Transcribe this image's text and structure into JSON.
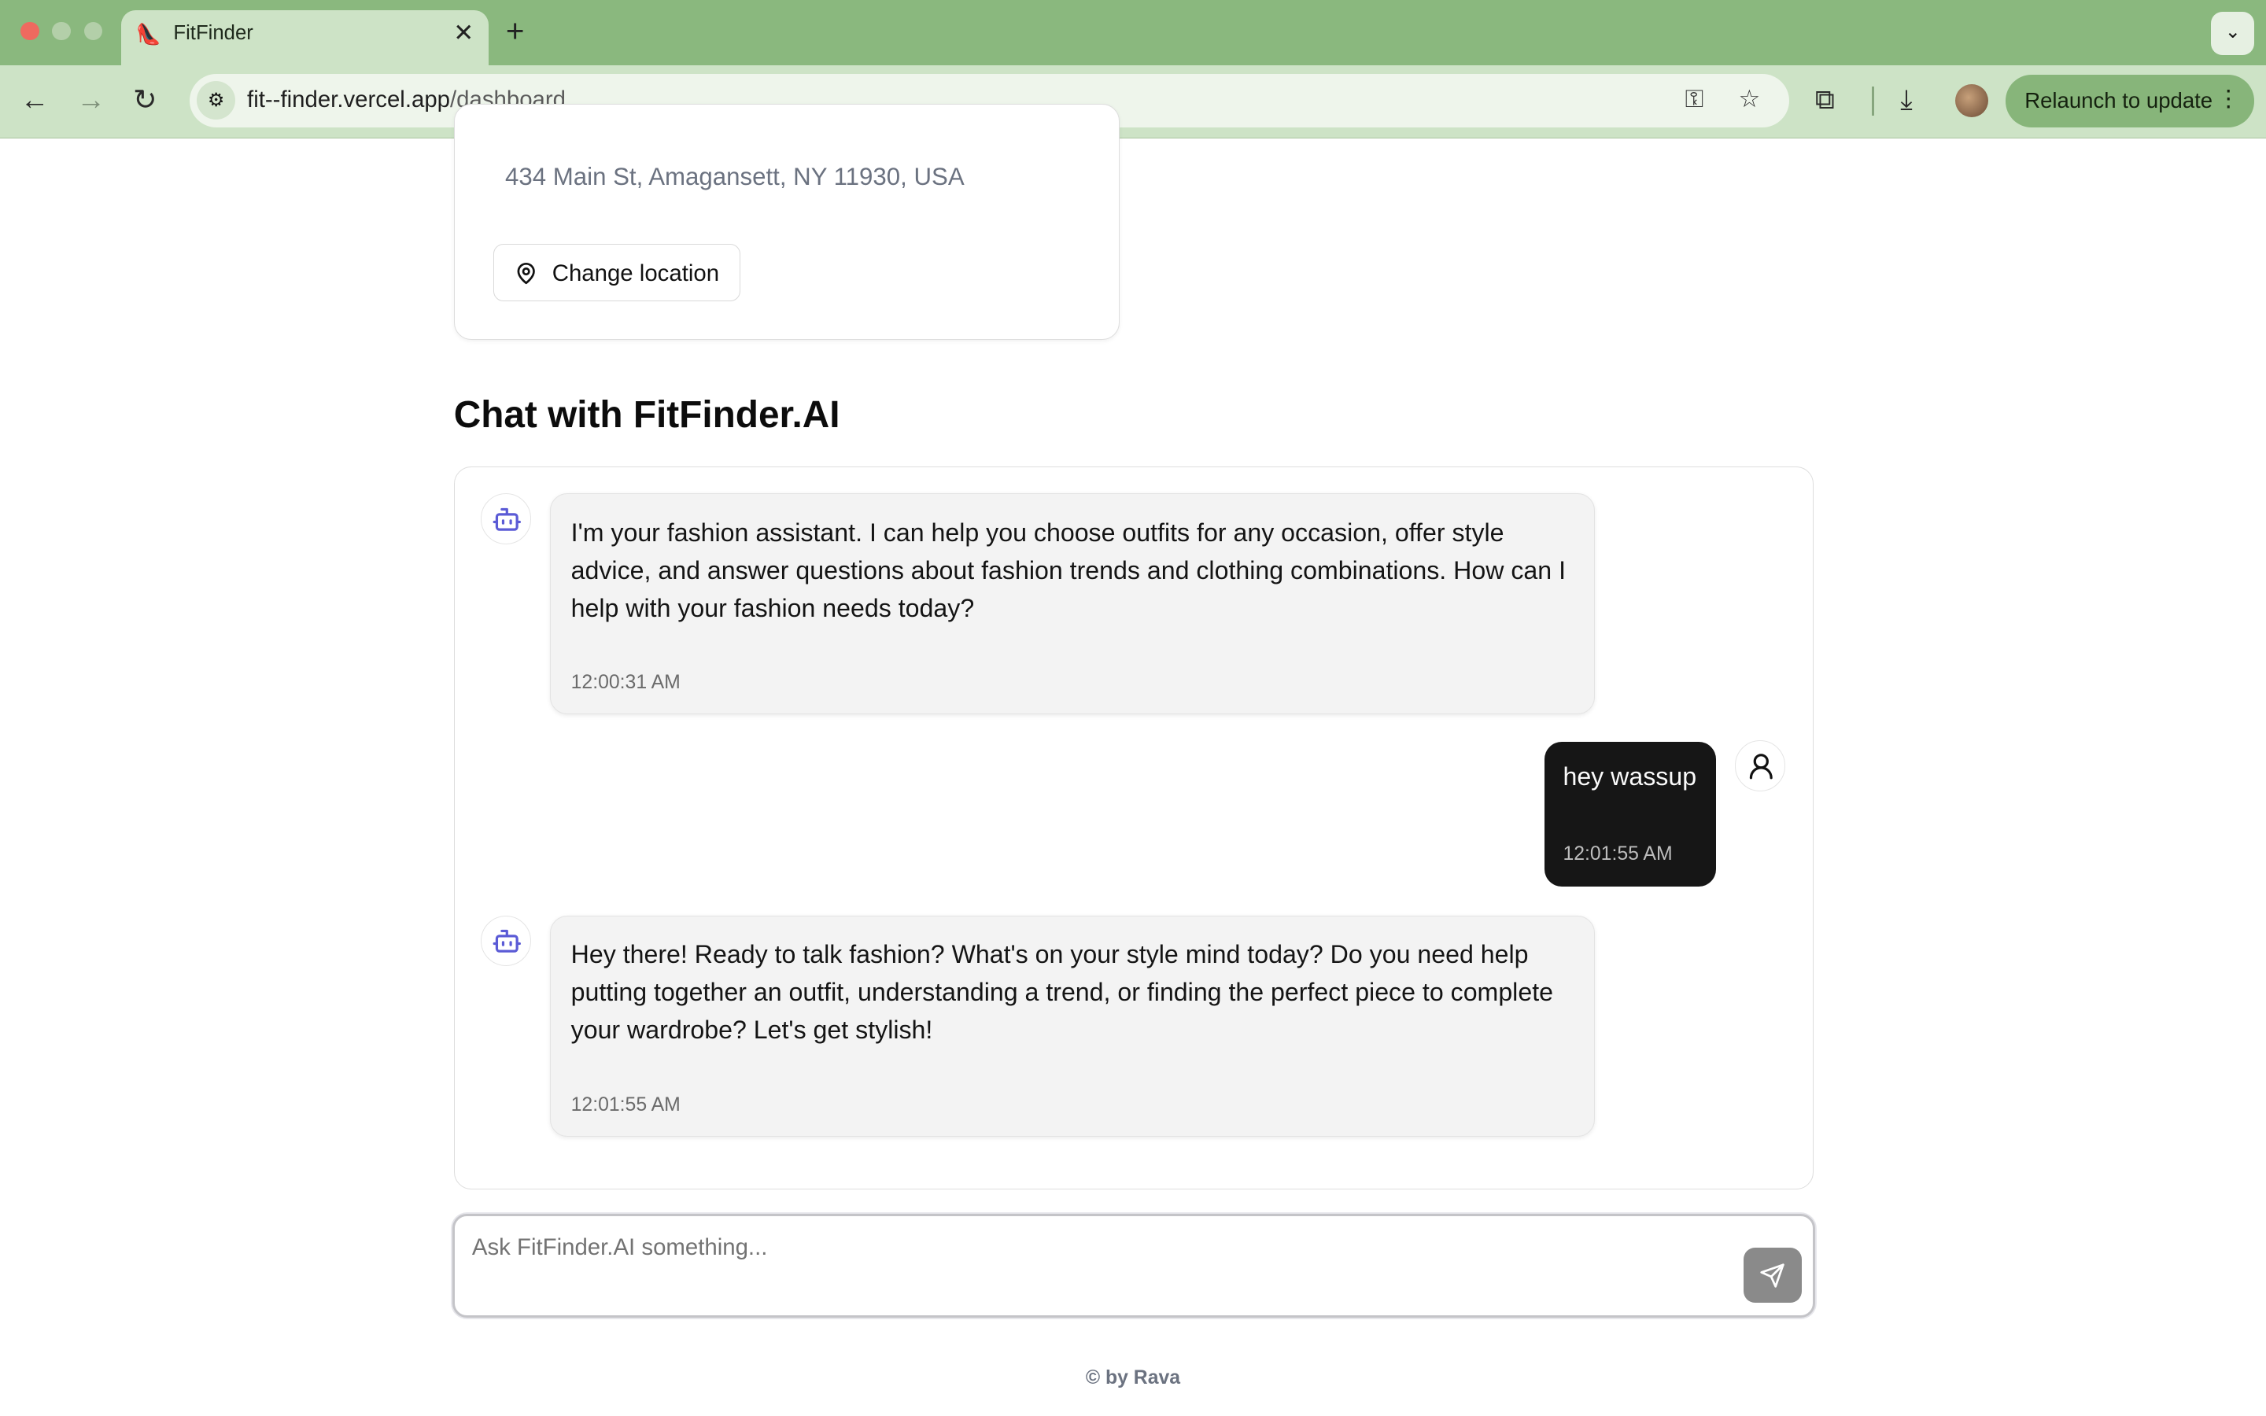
{
  "browser": {
    "tab_title": "FitFinder",
    "tab_favicon": "👠",
    "tab_close": "✕",
    "new_tab": "+",
    "tab_search": "⌄",
    "url_host": "fit--finder.vercel.app",
    "url_path": "/dashboard",
    "relaunch_label": "Relaunch to update",
    "relaunch_menu": "⋮",
    "icons": {
      "back": "←",
      "forward": "→",
      "reload": "↻",
      "site_info": "⚙",
      "password": "⚿",
      "bookmark": "☆",
      "extensions": "⧉",
      "download": "⤓"
    }
  },
  "location": {
    "address": "434 Main St, Amagansett, NY 11930, USA",
    "change_label": "Change location"
  },
  "chat": {
    "heading": "Chat with FitFinder.AI",
    "messages": [
      {
        "role": "bot",
        "text": "I'm your fashion assistant. I can help you choose outfits for any occasion, offer style advice, and answer questions about fashion trends and clothing combinations. How can I help with your fashion needs today?",
        "time": "12:00:31 AM"
      },
      {
        "role": "user",
        "text": "hey wassup",
        "time": "12:01:55 AM"
      },
      {
        "role": "bot",
        "text": "Hey there! Ready to talk fashion? What's on your style mind today? Do you need help putting together an outfit, understanding a trend, or finding the perfect piece to complete your wardrobe? Let's get stylish!",
        "time": "12:01:55 AM"
      }
    ],
    "input_placeholder": "Ask FitFinder.AI something...",
    "input_value": ""
  },
  "footer": "© by Rava",
  "colors": {
    "chrome": "#8ab87e",
    "toolbar": "#cde3c6",
    "bot_icon": "#5b5bd6",
    "user_bubble": "#161616",
    "send_button": "#8a8a8a"
  }
}
